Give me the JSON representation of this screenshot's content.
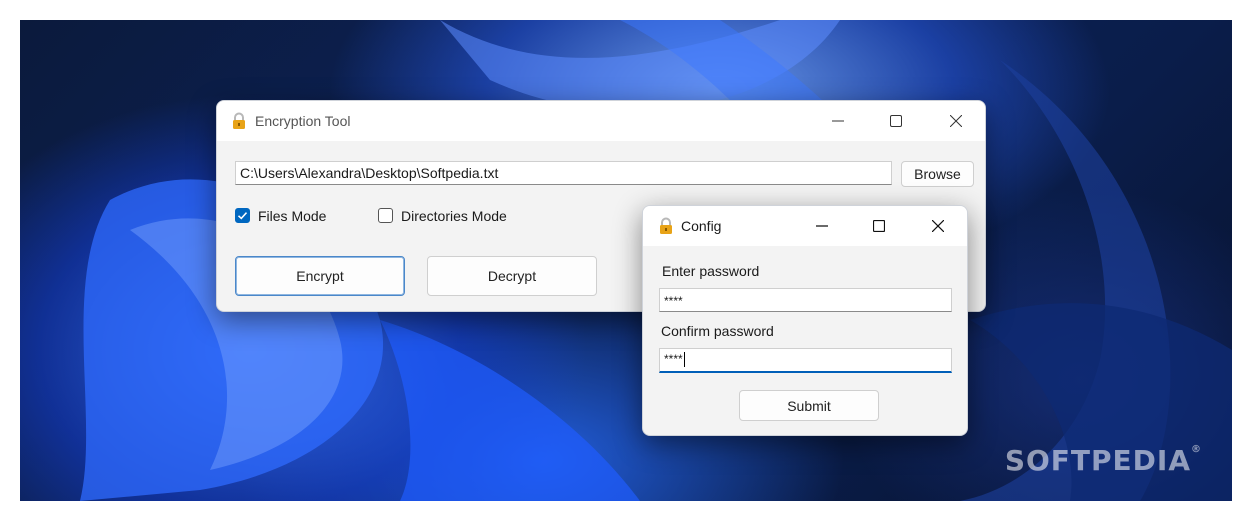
{
  "main_window": {
    "title": "Encryption Tool",
    "path_value": "C:\\Users\\Alexandra\\Desktop\\Softpedia.txt",
    "browse_label": "Browse",
    "files_mode_label": "Files Mode",
    "files_mode_checked": true,
    "directories_mode_label": "Directories Mode",
    "directories_mode_checked": false,
    "encrypt_label": "Encrypt",
    "decrypt_label": "Decrypt"
  },
  "config_window": {
    "title": "Config",
    "enter_password_label": "Enter password",
    "enter_password_value": "****",
    "confirm_password_label": "Confirm password",
    "confirm_password_value": "****",
    "submit_label": "Submit"
  },
  "watermark": {
    "text": "SOFTPEDIA",
    "mark": "®"
  },
  "colors": {
    "accent": "#0067c0",
    "lock": "#e8a317"
  }
}
